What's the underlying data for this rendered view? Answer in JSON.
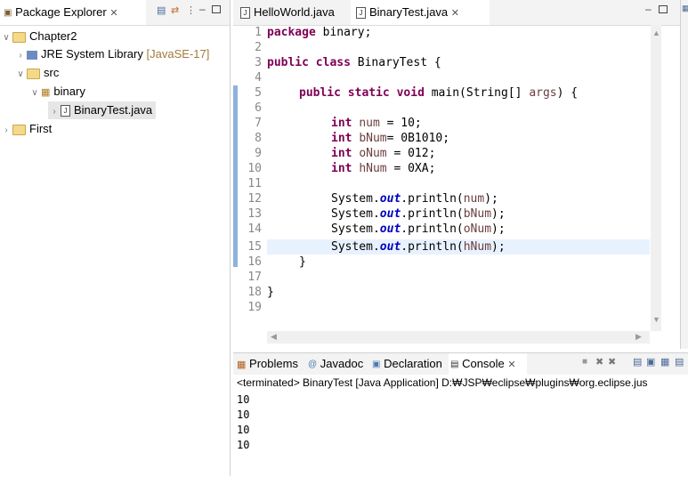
{
  "left_panel": {
    "tab_label": "Package Explorer",
    "tree": [
      {
        "label": "Chapter2",
        "suffix": ""
      },
      {
        "label": "JRE System Library",
        "suffix": "[JavaSE-17]"
      },
      {
        "label": "src",
        "suffix": ""
      },
      {
        "label": "binary",
        "suffix": ""
      },
      {
        "label": "BinaryTest.java",
        "suffix": ""
      },
      {
        "label": "First",
        "suffix": ""
      }
    ]
  },
  "editor": {
    "tabs": [
      {
        "label": "HelloWorld.java"
      },
      {
        "label": "BinaryTest.java"
      }
    ],
    "line_numbers": [
      "1",
      "2",
      "3",
      "4",
      "5",
      "6",
      "7",
      "8",
      "9",
      "10",
      "11",
      "12",
      "13",
      "14",
      "15",
      "16",
      "17",
      "18",
      "19"
    ],
    "code": {
      "l1_kw": "package",
      "l1_rest": " binary;",
      "l3_kw1": "public",
      "l3_kw2": "class",
      "l3_rest": " BinaryTest {",
      "l5_kw1": "public",
      "l5_kw2": "static",
      "l5_kw3": "void",
      "l5_rest": " main(String[] ",
      "l5_args": "args",
      "l5_end": ") {",
      "l7_kw": "int",
      "l7_var": "num",
      "l7_rest": " = 10;",
      "l8_kw": "int",
      "l8_var": "bNum",
      "l8_rest": "= 0B1010;",
      "l9_kw": "int",
      "l9_var": "oNum",
      "l9_rest": " = 012;",
      "l10_kw": "int",
      "l10_var": "hNum",
      "l10_rest": " = 0XA;",
      "sys": "System.",
      "out": "out",
      "println": ".println(",
      "l12_var": "num",
      "l13_var": "bNum",
      "l14_var": "oNum",
      "l15_var": "hNum",
      "close_paren": ");",
      "l16": "}",
      "l18": "}"
    }
  },
  "console": {
    "tabs": [
      {
        "label": "Problems"
      },
      {
        "label": "Javadoc"
      },
      {
        "label": "Declaration"
      },
      {
        "label": "Console"
      }
    ],
    "terminated": "<terminated> BinaryTest [Java Application] D:₩JSP₩eclipse₩plugins₩org.eclipse.jus",
    "output": [
      "10",
      "10",
      "10",
      "10"
    ]
  }
}
